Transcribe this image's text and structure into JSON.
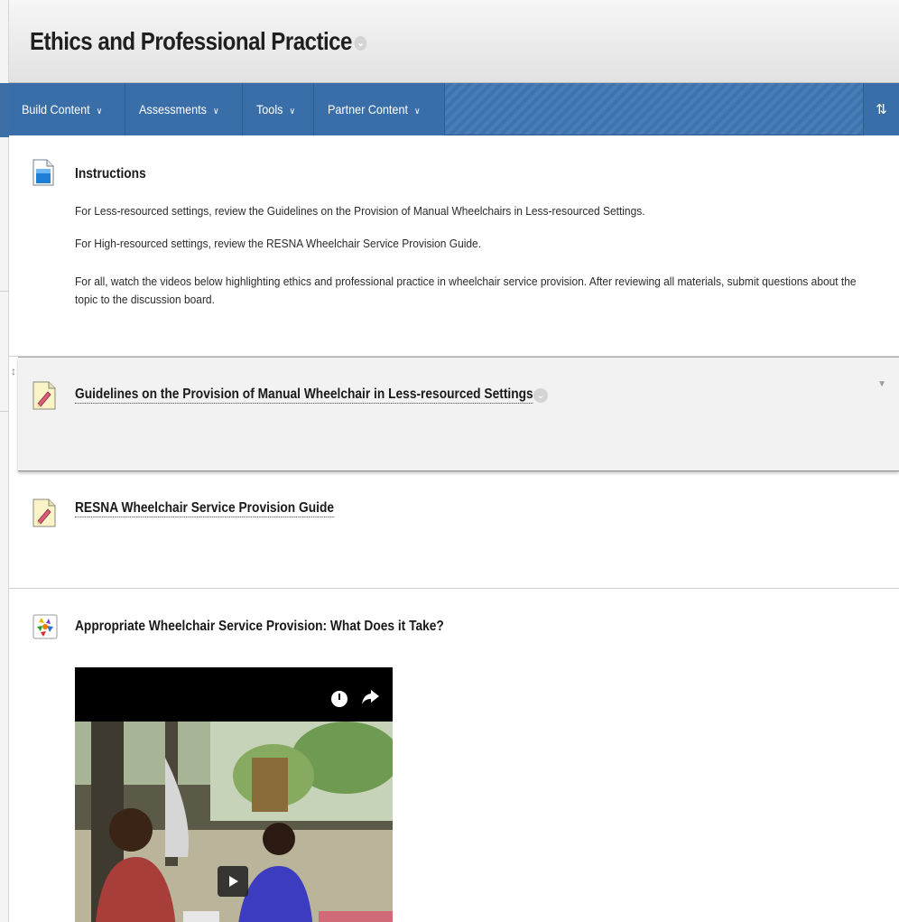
{
  "page": {
    "title": "Ethics and Professional Practice"
  },
  "menu": {
    "items": [
      {
        "label": "Build Content"
      },
      {
        "label": "Assessments"
      },
      {
        "label": "Tools"
      },
      {
        "label": "Partner Content"
      }
    ],
    "caret": "∨",
    "reorder_glyph": "⇅"
  },
  "content": {
    "instructions": {
      "title": "Instructions",
      "paragraphs": [
        "For Less-resourced settings, review the Guidelines on the Provision of Manual Wheelchairs in Less-resourced Settings.",
        "For High-resourced settings, review the RESNA Wheelchair Service Provision Guide.",
        "For all, watch the videos below highlighting ethics and professional practice in wheelchair service provision. After reviewing all materials, submit questions about the topic to the discussion board."
      ],
      "icon": "document-icon"
    },
    "guidelines": {
      "title": "Guidelines on the Provision of Manual Wheelchair in Less-resourced Settings",
      "icon": "file-pencil-icon"
    },
    "resna": {
      "title": "RESNA Wheelchair Service Provision Guide",
      "icon": "file-pencil-icon"
    },
    "video": {
      "title": "Appropriate Wheelchair Service Provision: What Does it Take?",
      "icon": "multimedia-icon"
    }
  },
  "colors": {
    "action_bar": "#3f73ad",
    "menu_item": "#3a6ea8",
    "title_text": "#1f1f1f"
  }
}
